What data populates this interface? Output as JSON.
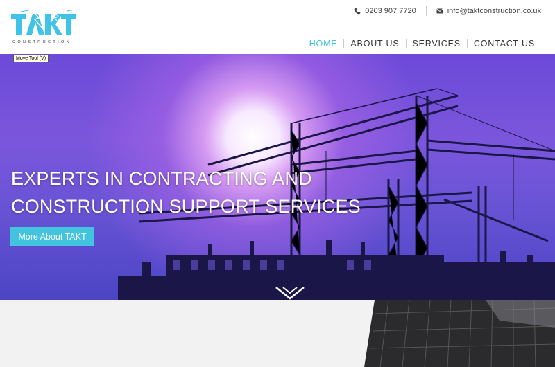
{
  "header": {
    "logo_sub": "CONSTRUCTION",
    "phone": "0203 907 7720",
    "email": "info@taktconstruction.co.uk"
  },
  "nav": {
    "items": [
      "HOME",
      "ABOUT US",
      "SERVICES",
      "CONTACT US"
    ],
    "active": "HOME"
  },
  "tooltip": "Move Tool (V)",
  "hero": {
    "title_line1": "EXPERTS IN CONTRACTING AND",
    "title_line2": "CONSTRUCTION SUPPORT SERVICES",
    "button_label": "More About TAKT"
  },
  "colors": {
    "accent": "#42c4de",
    "hero_purple": "#6c4ad8",
    "silhouette": "#1a1748"
  },
  "icons": {
    "phone": "phone-icon",
    "email": "envelope-icon",
    "scroll": "chevron-down-icon"
  }
}
